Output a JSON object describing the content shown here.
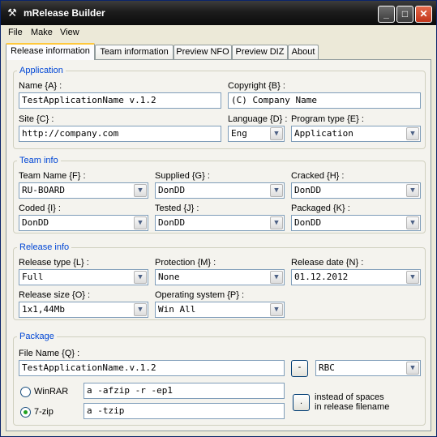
{
  "window": {
    "title": "mRelease Builder"
  },
  "menu": [
    "File",
    "Make",
    "View"
  ],
  "tabs": [
    "Release information",
    "Team information",
    "Preview NFO",
    "Preview DIZ",
    "About"
  ],
  "application": {
    "title": "Application",
    "name_label": "Name {A} :",
    "name_value": "TestApplicationName v.1.2",
    "copyright_label": "Copyright {B} :",
    "copyright_value": "(C) Company Name",
    "site_label": "Site {C} :",
    "site_value": "http://company.com",
    "language_label": "Language {D} :",
    "language_value": "Eng",
    "program_type_label": "Program type {E} :",
    "program_type_value": "Application"
  },
  "team": {
    "title": "Team info",
    "team_name_label": "Team Name {F} :",
    "team_name_value": "RU-BOARD",
    "supplied_label": "Supplied {G} :",
    "supplied_value": "DonDD",
    "cracked_label": "Cracked {H} :",
    "cracked_value": "DonDD",
    "coded_label": "Coded {I} :",
    "coded_value": "DonDD",
    "tested_label": "Tested {J} :",
    "tested_value": "DonDD",
    "packaged_label": "Packaged {K} :",
    "packaged_value": "DonDD"
  },
  "release": {
    "title": "Release info",
    "type_label": "Release type {L} :",
    "type_value": "Full",
    "protection_label": "Protection {M} :",
    "protection_value": "None",
    "date_label": "Release date {N} :",
    "date_value": "01.12.2012",
    "size_label": "Release size {O} :",
    "size_value": "1x1,44Mb",
    "os_label": "Operating system {P} :",
    "os_value": "Win All"
  },
  "package": {
    "title": "Package",
    "file_name_label": "File Name {Q} :",
    "file_name_value": "TestApplicationName.v.1.2",
    "dash_button": "-",
    "suffix_value": "RBC",
    "winrar_label": "WinRAR",
    "winrar_command": "a -afzip -r -ep1",
    "sevenzip_label": "7-zip",
    "sevenzip_command": "a -tzip",
    "selected_archiver": "7-zip",
    "space_char_button": ".",
    "spaces_note_line1": "instead of spaces",
    "spaces_note_line2": "in release filename"
  }
}
